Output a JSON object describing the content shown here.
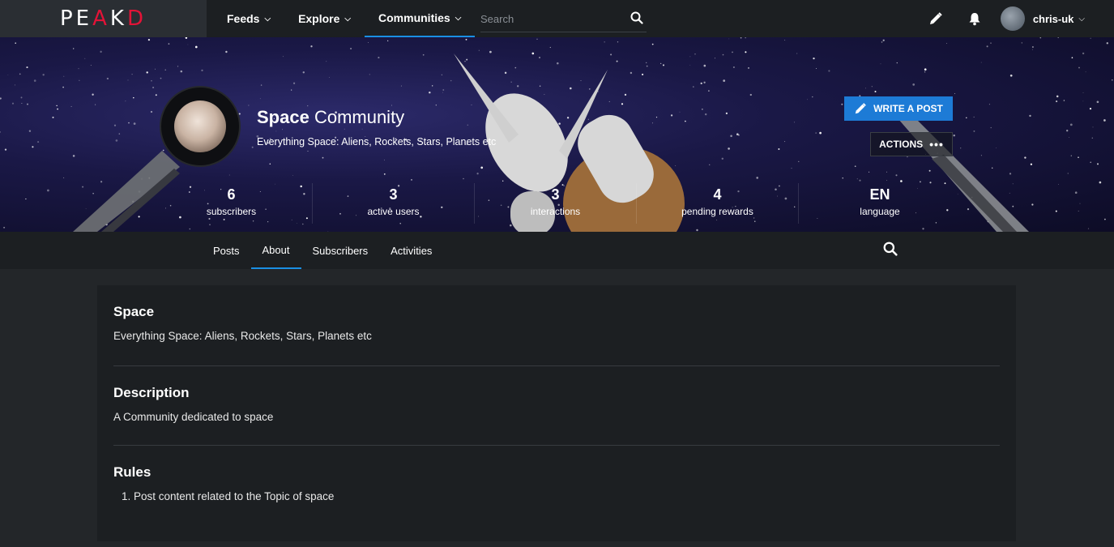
{
  "topbar": {
    "logo": {
      "a": "PE",
      "k": "A",
      "b": "K",
      "d": "D"
    },
    "nav": [
      {
        "label": "Feeds",
        "active": false
      },
      {
        "label": "Explore",
        "active": false
      },
      {
        "label": "Communities",
        "active": true
      }
    ],
    "search_placeholder": "Search",
    "username": "chris-uk"
  },
  "banner": {
    "title_bold": "Space",
    "title_rest": " Community",
    "subtitle": "Everything Space: Aliens, Rockets, Stars, Planets etc",
    "write_label": "WRITE A POST",
    "actions_label": "ACTIONS",
    "stats": [
      {
        "num": "6",
        "label": "subscribers"
      },
      {
        "num": "3",
        "label": "active users"
      },
      {
        "num": "3",
        "label": "interactions"
      },
      {
        "num": "4",
        "label": "pending rewards"
      },
      {
        "num": "EN",
        "label": "language"
      }
    ]
  },
  "tabs": [
    {
      "label": "Posts",
      "active": false
    },
    {
      "label": "About",
      "active": true
    },
    {
      "label": "Subscribers",
      "active": false
    },
    {
      "label": "Activities",
      "active": false
    }
  ],
  "about": {
    "name_title": "Space",
    "name_text": "Everything Space: Aliens, Rockets, Stars, Planets etc",
    "desc_title": "Description",
    "desc_text": "A Community dedicated to space",
    "rules_title": "Rules",
    "rules": [
      "Post content related to the Topic of space"
    ]
  },
  "colors": {
    "accent": "#1a8fe3",
    "brand": "#e31337",
    "button": "#1d7bd6"
  },
  "icons": [
    "search-icon",
    "pencil-icon",
    "bell-icon",
    "chevron-down-icon",
    "more-dots-icon"
  ]
}
